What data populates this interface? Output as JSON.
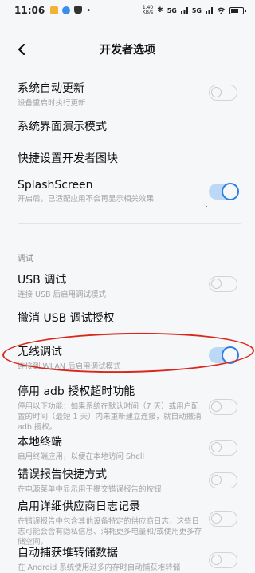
{
  "status_bar": {
    "time": "11:06",
    "speed_value": "1.40",
    "speed_unit": "KB/s",
    "signal_1": "5G",
    "signal_2": "5G",
    "battery_level": 0.75
  },
  "header": {
    "title": "开发者选项"
  },
  "items": [
    {
      "label": "系统自动更新",
      "sub": "设备重启时执行更新",
      "toggle": "off"
    },
    {
      "label": "系统界面演示模式",
      "sub": "",
      "toggle": null
    },
    {
      "label": "快捷设置开发者图块",
      "sub": "",
      "toggle": null
    },
    {
      "label": "SplashScreen",
      "sub": "开启后，已适配应用不会再显示相关效果",
      "toggle": "on"
    },
    {
      "label": "USB 调试",
      "sub": "连接 USB 后启用调试模式",
      "toggle": "off"
    },
    {
      "label": "撤消 USB 调试授权",
      "sub": "",
      "toggle": null
    },
    {
      "label": "无线调试",
      "sub": "连接到 WLAN 后启用调试模式",
      "toggle": "on"
    },
    {
      "label": "停用 adb 授权超时功能",
      "sub": "停用以下功能：如果系统在默认时间（7 天）或用户配置的时间（最短 1 天）内未重新建立连接，就自动撤消 adb 授权。",
      "toggle": "off"
    },
    {
      "label": "本地终端",
      "sub": "启用终端应用，以便在本地访问 Shell",
      "toggle": "off"
    },
    {
      "label": "错误报告快捷方式",
      "sub": "在电源菜单中显示用于提交错误报告的按钮",
      "toggle": "off"
    },
    {
      "label": "启用详细供应商日志记录",
      "sub": "在错误报告中包含其他设备特定的供应商日志，这些日志可能会含有隐私信息、消耗更多电量和/或使用更多存储空间。",
      "toggle": "off"
    },
    {
      "label": "自动捕获堆转储数据",
      "sub": "在 Android 系统使用过多内存时自动捕获堆转储",
      "toggle": "off"
    }
  ],
  "section": {
    "debug_label": "调试"
  },
  "colors": {
    "accent": "#2f7fe3",
    "highlight": "#d9271e"
  }
}
